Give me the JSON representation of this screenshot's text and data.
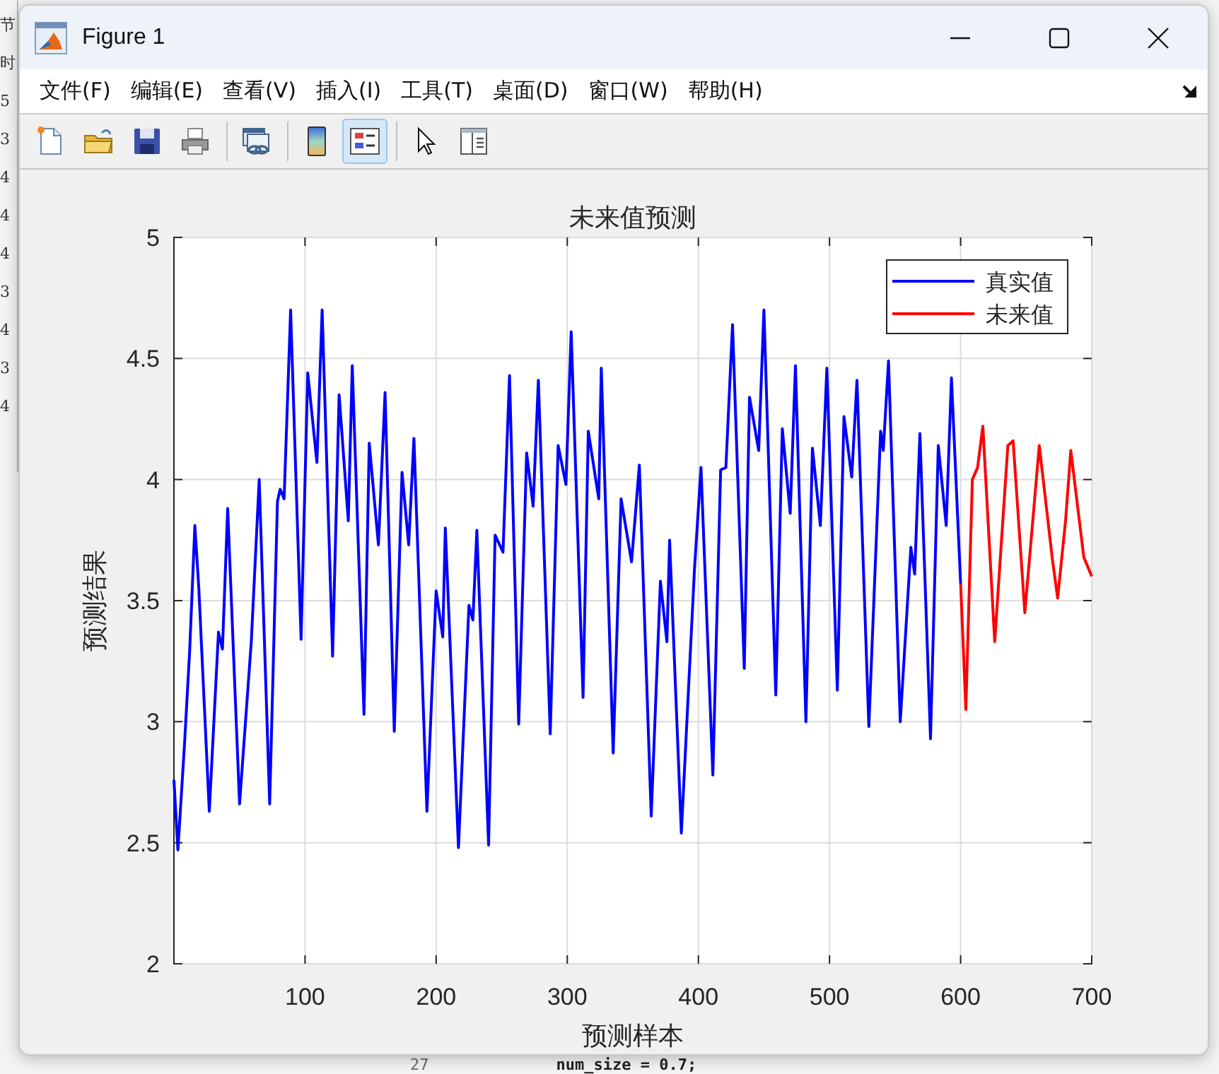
{
  "background": {
    "left_fragments": [
      "节",
      "时",
      "5",
      "3",
      "4",
      "4",
      "4",
      "3",
      "4",
      "3",
      "4"
    ],
    "line_number": "27",
    "code": "num_size = 0.7;"
  },
  "window": {
    "title": "Figure 1"
  },
  "menu": [
    "文件(F)",
    "编辑(E)",
    "查看(V)",
    "插入(I)",
    "工具(T)",
    "桌面(D)",
    "窗口(W)",
    "帮助(H)"
  ],
  "toolbar": [
    {
      "kind": "new",
      "pressed": false
    },
    {
      "kind": "open",
      "pressed": false
    },
    {
      "kind": "save",
      "pressed": false
    },
    {
      "kind": "print",
      "pressed": false
    },
    {
      "kind": "separator"
    },
    {
      "kind": "link",
      "pressed": false
    },
    {
      "kind": "separator"
    },
    {
      "kind": "colorbar",
      "pressed": false
    },
    {
      "kind": "legend",
      "pressed": true
    },
    {
      "kind": "separator"
    },
    {
      "kind": "pointer",
      "pressed": false
    },
    {
      "kind": "property",
      "pressed": false
    }
  ],
  "figure": {
    "chart_data": {
      "type": "line",
      "grid": true,
      "legend": true,
      "title": "未来值预测",
      "xlabel": "预测样本",
      "ylabel": "预测结果",
      "xlim": [
        0,
        700
      ],
      "ylim": [
        2,
        5
      ],
      "xticks": [
        100,
        200,
        300,
        400,
        500,
        600,
        700
      ],
      "yticks": [
        2,
        2.5,
        3,
        3.5,
        4,
        4.5,
        5
      ],
      "x": [
        0,
        3,
        8,
        12,
        16,
        19,
        27,
        34,
        37,
        41,
        50,
        59,
        65,
        73,
        79,
        81,
        84,
        89,
        97,
        102,
        109,
        113,
        121,
        126,
        133,
        136,
        145,
        149,
        156,
        161,
        168,
        174,
        179,
        183,
        193,
        200,
        205,
        207,
        217,
        225,
        228,
        231,
        240,
        245,
        251,
        256,
        263,
        269,
        274,
        278,
        287,
        293,
        299,
        303,
        312,
        316,
        324,
        326,
        335,
        341,
        349,
        355,
        364,
        371,
        376,
        378,
        387,
        397,
        402,
        411,
        417,
        421,
        426,
        435,
        439,
        446,
        450,
        459,
        464,
        470,
        474,
        482,
        487,
        493,
        498,
        506,
        511,
        517,
        521,
        530,
        539,
        541,
        545,
        554,
        562,
        565,
        569,
        577,
        583,
        589,
        593,
        600,
        604,
        609,
        613,
        617,
        626,
        636,
        640,
        649,
        660,
        670,
        674,
        680,
        684,
        694,
        700
      ],
      "series": [
        {
          "name": "真实值",
          "color": "#0000ff",
          "values": [
            2.76,
            2.47,
            2.9,
            3.29,
            3.81,
            3.55,
            2.63,
            3.37,
            3.3,
            3.88,
            2.66,
            3.33,
            4.0,
            2.66,
            3.91,
            3.96,
            3.92,
            4.7,
            3.34,
            4.44,
            4.07,
            4.7,
            3.27,
            4.35,
            3.83,
            4.47,
            3.03,
            4.15,
            3.73,
            4.36,
            2.96,
            4.03,
            3.73,
            4.17,
            2.63,
            3.54,
            3.35,
            3.8,
            2.48,
            3.48,
            3.42,
            3.79,
            2.49,
            3.77,
            3.7,
            4.43,
            2.99,
            4.11,
            3.89,
            4.41,
            2.95,
            4.14,
            3.98,
            4.61,
            3.1,
            4.2,
            3.92,
            4.46,
            2.87,
            3.92,
            3.66,
            4.06,
            2.61,
            3.58,
            3.33,
            3.75,
            2.54,
            3.63,
            4.05,
            2.78,
            4.04,
            4.05,
            4.64,
            3.22,
            4.34,
            4.12,
            4.7,
            3.11,
            4.21,
            3.86,
            4.47,
            3.0,
            4.13,
            3.81,
            4.46,
            3.13,
            4.26,
            4.01,
            4.41,
            2.98,
            4.2,
            4.12,
            4.49,
            3.0,
            3.72,
            3.61,
            4.19,
            2.93,
            4.14,
            3.81,
            4.42,
            3.57,
            null,
            null,
            null,
            null,
            null,
            null,
            null,
            null,
            null,
            null,
            null,
            null,
            null,
            null,
            null
          ]
        },
        {
          "name": "未来值",
          "color": "#ff0000",
          "values": [
            null,
            null,
            null,
            null,
            null,
            null,
            null,
            null,
            null,
            null,
            null,
            null,
            null,
            null,
            null,
            null,
            null,
            null,
            null,
            null,
            null,
            null,
            null,
            null,
            null,
            null,
            null,
            null,
            null,
            null,
            null,
            null,
            null,
            null,
            null,
            null,
            null,
            null,
            null,
            null,
            null,
            null,
            null,
            null,
            null,
            null,
            null,
            null,
            null,
            null,
            null,
            null,
            null,
            null,
            null,
            null,
            null,
            null,
            null,
            null,
            null,
            null,
            null,
            null,
            null,
            null,
            null,
            null,
            null,
            null,
            null,
            null,
            null,
            null,
            null,
            null,
            null,
            null,
            null,
            null,
            null,
            null,
            null,
            null,
            null,
            null,
            null,
            null,
            null,
            null,
            null,
            null,
            null,
            null,
            null,
            null,
            null,
            null,
            null,
            null,
            null,
            3.57,
            3.05,
            4.0,
            4.05,
            4.22,
            3.33,
            4.14,
            4.16,
            3.45,
            4.14,
            3.67,
            3.51,
            3.83,
            4.12,
            3.68,
            3.6
          ]
        }
      ]
    }
  }
}
